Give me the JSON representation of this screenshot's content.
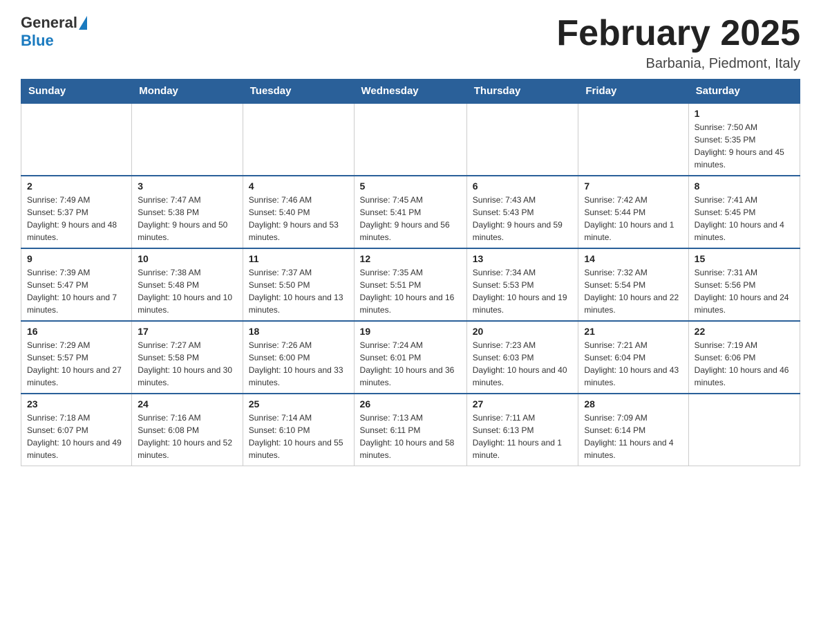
{
  "header": {
    "logo_general": "General",
    "logo_blue": "Blue",
    "month_title": "February 2025",
    "location": "Barbania, Piedmont, Italy"
  },
  "days_of_week": [
    "Sunday",
    "Monday",
    "Tuesday",
    "Wednesday",
    "Thursday",
    "Friday",
    "Saturday"
  ],
  "weeks": [
    {
      "days": [
        {
          "number": "",
          "info": ""
        },
        {
          "number": "",
          "info": ""
        },
        {
          "number": "",
          "info": ""
        },
        {
          "number": "",
          "info": ""
        },
        {
          "number": "",
          "info": ""
        },
        {
          "number": "",
          "info": ""
        },
        {
          "number": "1",
          "info": "Sunrise: 7:50 AM\nSunset: 5:35 PM\nDaylight: 9 hours and 45 minutes."
        }
      ]
    },
    {
      "days": [
        {
          "number": "2",
          "info": "Sunrise: 7:49 AM\nSunset: 5:37 PM\nDaylight: 9 hours and 48 minutes."
        },
        {
          "number": "3",
          "info": "Sunrise: 7:47 AM\nSunset: 5:38 PM\nDaylight: 9 hours and 50 minutes."
        },
        {
          "number": "4",
          "info": "Sunrise: 7:46 AM\nSunset: 5:40 PM\nDaylight: 9 hours and 53 minutes."
        },
        {
          "number": "5",
          "info": "Sunrise: 7:45 AM\nSunset: 5:41 PM\nDaylight: 9 hours and 56 minutes."
        },
        {
          "number": "6",
          "info": "Sunrise: 7:43 AM\nSunset: 5:43 PM\nDaylight: 9 hours and 59 minutes."
        },
        {
          "number": "7",
          "info": "Sunrise: 7:42 AM\nSunset: 5:44 PM\nDaylight: 10 hours and 1 minute."
        },
        {
          "number": "8",
          "info": "Sunrise: 7:41 AM\nSunset: 5:45 PM\nDaylight: 10 hours and 4 minutes."
        }
      ]
    },
    {
      "days": [
        {
          "number": "9",
          "info": "Sunrise: 7:39 AM\nSunset: 5:47 PM\nDaylight: 10 hours and 7 minutes."
        },
        {
          "number": "10",
          "info": "Sunrise: 7:38 AM\nSunset: 5:48 PM\nDaylight: 10 hours and 10 minutes."
        },
        {
          "number": "11",
          "info": "Sunrise: 7:37 AM\nSunset: 5:50 PM\nDaylight: 10 hours and 13 minutes."
        },
        {
          "number": "12",
          "info": "Sunrise: 7:35 AM\nSunset: 5:51 PM\nDaylight: 10 hours and 16 minutes."
        },
        {
          "number": "13",
          "info": "Sunrise: 7:34 AM\nSunset: 5:53 PM\nDaylight: 10 hours and 19 minutes."
        },
        {
          "number": "14",
          "info": "Sunrise: 7:32 AM\nSunset: 5:54 PM\nDaylight: 10 hours and 22 minutes."
        },
        {
          "number": "15",
          "info": "Sunrise: 7:31 AM\nSunset: 5:56 PM\nDaylight: 10 hours and 24 minutes."
        }
      ]
    },
    {
      "days": [
        {
          "number": "16",
          "info": "Sunrise: 7:29 AM\nSunset: 5:57 PM\nDaylight: 10 hours and 27 minutes."
        },
        {
          "number": "17",
          "info": "Sunrise: 7:27 AM\nSunset: 5:58 PM\nDaylight: 10 hours and 30 minutes."
        },
        {
          "number": "18",
          "info": "Sunrise: 7:26 AM\nSunset: 6:00 PM\nDaylight: 10 hours and 33 minutes."
        },
        {
          "number": "19",
          "info": "Sunrise: 7:24 AM\nSunset: 6:01 PM\nDaylight: 10 hours and 36 minutes."
        },
        {
          "number": "20",
          "info": "Sunrise: 7:23 AM\nSunset: 6:03 PM\nDaylight: 10 hours and 40 minutes."
        },
        {
          "number": "21",
          "info": "Sunrise: 7:21 AM\nSunset: 6:04 PM\nDaylight: 10 hours and 43 minutes."
        },
        {
          "number": "22",
          "info": "Sunrise: 7:19 AM\nSunset: 6:06 PM\nDaylight: 10 hours and 46 minutes."
        }
      ]
    },
    {
      "days": [
        {
          "number": "23",
          "info": "Sunrise: 7:18 AM\nSunset: 6:07 PM\nDaylight: 10 hours and 49 minutes."
        },
        {
          "number": "24",
          "info": "Sunrise: 7:16 AM\nSunset: 6:08 PM\nDaylight: 10 hours and 52 minutes."
        },
        {
          "number": "25",
          "info": "Sunrise: 7:14 AM\nSunset: 6:10 PM\nDaylight: 10 hours and 55 minutes."
        },
        {
          "number": "26",
          "info": "Sunrise: 7:13 AM\nSunset: 6:11 PM\nDaylight: 10 hours and 58 minutes."
        },
        {
          "number": "27",
          "info": "Sunrise: 7:11 AM\nSunset: 6:13 PM\nDaylight: 11 hours and 1 minute."
        },
        {
          "number": "28",
          "info": "Sunrise: 7:09 AM\nSunset: 6:14 PM\nDaylight: 11 hours and 4 minutes."
        },
        {
          "number": "",
          "info": ""
        }
      ]
    }
  ]
}
